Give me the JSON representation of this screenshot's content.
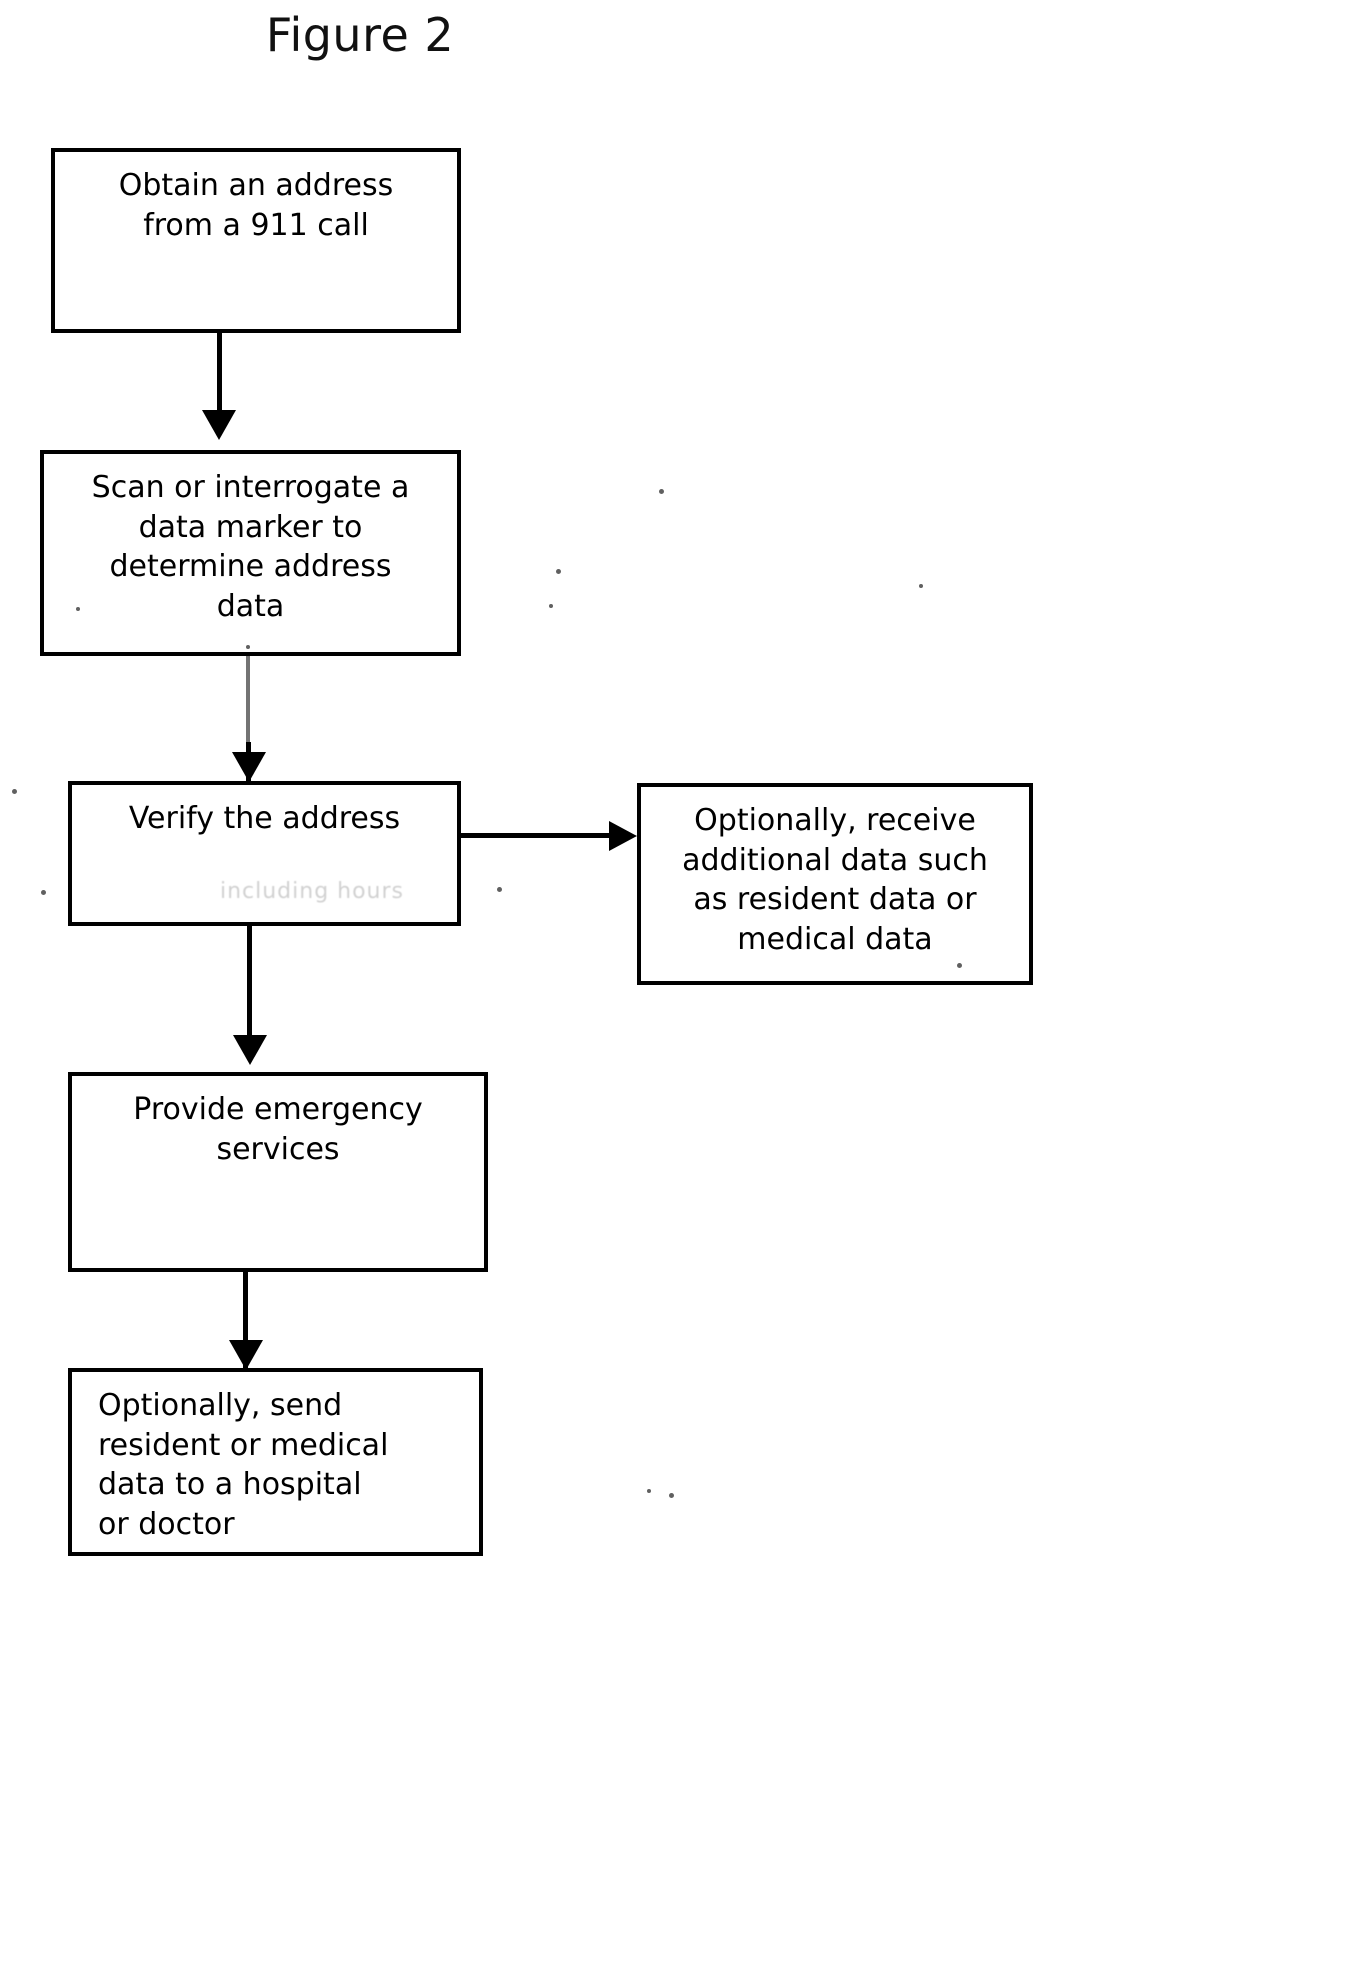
{
  "figure": {
    "title": "Figure 2",
    "type": "flowchart"
  },
  "nodes": [
    {
      "id": "obtain-address",
      "text": "Obtain an address\nfrom a 911 call"
    },
    {
      "id": "scan-marker",
      "text": "Scan or interrogate a\ndata marker to\ndetermine address\ndata"
    },
    {
      "id": "verify-address",
      "text": "Verify the address",
      "smudged_text": "including hours"
    },
    {
      "id": "optional-receive-data",
      "text": "Optionally, receive\nadditional data such\nas resident data or\nmedical data"
    },
    {
      "id": "provide-services",
      "text": "Provide emergency\nservices"
    },
    {
      "id": "optional-send-data",
      "text": "Optionally, send\nresident or medical\ndata to a hospital\nor doctor"
    }
  ],
  "edges": [
    {
      "id": "edge-obtain-to-scan",
      "from": "obtain-address",
      "to": "scan-marker",
      "direction": "down"
    },
    {
      "id": "edge-scan-to-verify",
      "from": "scan-marker",
      "to": "verify-address",
      "direction": "down"
    },
    {
      "id": "edge-verify-to-optional-receive",
      "from": "verify-address",
      "to": "optional-receive-data",
      "direction": "right"
    },
    {
      "id": "edge-verify-to-provide",
      "from": "verify-address",
      "to": "provide-services",
      "direction": "down"
    },
    {
      "id": "edge-provide-to-optional-send",
      "from": "provide-services",
      "to": "optional-send-data",
      "direction": "down"
    }
  ],
  "colors": {
    "ink": "#000000",
    "page": "#ffffff"
  }
}
